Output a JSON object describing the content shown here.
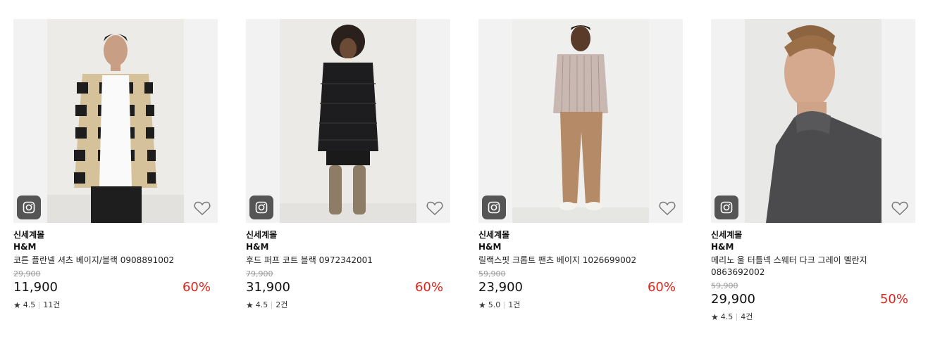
{
  "products": [
    {
      "mall": "신세계몰",
      "brand": "H&M",
      "title": "코튼 플란넬 셔츠 베이지/블랙 0908891002",
      "original_price": "29,900",
      "price": "11,900",
      "discount": "60%",
      "rating": "4.5",
      "reviews": "11건",
      "icons": [
        "instagram-icon",
        "heart-icon",
        "star-icon"
      ]
    },
    {
      "mall": "신세계몰",
      "brand": "H&M",
      "title": "후드 퍼프 코트 블랙 0972342001",
      "original_price": "79,900",
      "price": "31,900",
      "discount": "60%",
      "rating": "4.5",
      "reviews": "2건",
      "icons": [
        "instagram-icon",
        "heart-icon",
        "star-icon"
      ]
    },
    {
      "mall": "신세계몰",
      "brand": "H&M",
      "title": "릴랙스핏 크롭트 팬츠 베이지 1026699002",
      "original_price": "59,900",
      "price": "23,900",
      "discount": "60%",
      "rating": "5.0",
      "reviews": "1건",
      "icons": [
        "instagram-icon",
        "heart-icon",
        "star-icon"
      ]
    },
    {
      "mall": "신세계몰",
      "brand": "H&M",
      "title": "메리노 울 터틀넥 스웨터 다크 그레이 멜란지 0863692002",
      "original_price": "59,900",
      "price": "29,900",
      "discount": "50%",
      "rating": "4.5",
      "reviews": "4건",
      "icons": [
        "instagram-icon",
        "heart-icon",
        "star-icon"
      ]
    }
  ],
  "colors": {
    "discount": "#e2231a",
    "badge": "#555555",
    "strike": "#999999"
  }
}
